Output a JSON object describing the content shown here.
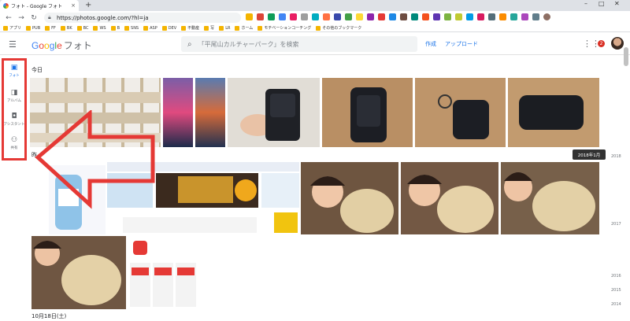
{
  "browser": {
    "tab_title": "フォト - Google フォト",
    "new_tab": "+",
    "url": "https://photos.google.com/?hl=ja",
    "window_controls": [
      "–",
      "□",
      "✕"
    ]
  },
  "bookmarks": [
    "アプリ",
    "PUB",
    "FF",
    "BK",
    "BC",
    "WS",
    "B",
    "SNS",
    "ASP",
    "DEV",
    "不動産",
    "写",
    "LR",
    "ホーム",
    "モチベーションコーチング",
    "その他のブックマーク"
  ],
  "app": {
    "logo_g": [
      "G",
      "o",
      "o",
      "g",
      "l",
      "e"
    ],
    "logo_photos": "フォト",
    "search_placeholder": "「平尾山カルチャーパーク」を検索",
    "create_label": "作成",
    "upload_label": "アップロード",
    "notification_count": "2"
  },
  "sidenav": [
    {
      "label": "フォト",
      "icon": "photo-icon",
      "active": true
    },
    {
      "label": "アルバム",
      "icon": "album-icon",
      "active": false
    },
    {
      "label": "アシスタント",
      "icon": "assistant-icon",
      "active": false
    },
    {
      "label": "共有",
      "icon": "share-icon",
      "active": false
    }
  ],
  "sections": {
    "today_label": "今日",
    "yesterday_label": "昨",
    "bottom_label": "10月18日(土)"
  },
  "timeline": {
    "tooltip": "2018年1月",
    "years": [
      "2018",
      "2017",
      "2016",
      "2015",
      "2014"
    ]
  },
  "colors": {
    "accent": "#1a73e8",
    "annotation_red": "#e53935"
  }
}
